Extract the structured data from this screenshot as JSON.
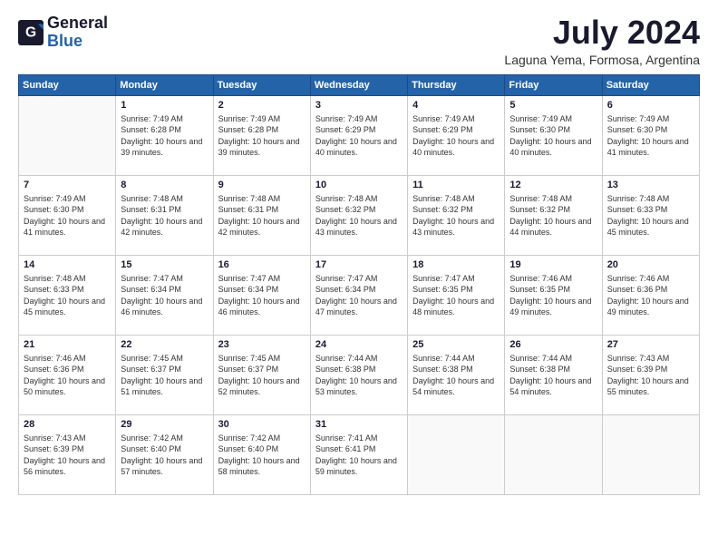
{
  "logo": {
    "text_general": "General",
    "text_blue": "Blue"
  },
  "header": {
    "month_year": "July 2024",
    "location": "Laguna Yema, Formosa, Argentina"
  },
  "weekdays": [
    "Sunday",
    "Monday",
    "Tuesday",
    "Wednesday",
    "Thursday",
    "Friday",
    "Saturday"
  ],
  "weeks": [
    [
      {
        "day": "",
        "sunrise": "",
        "sunset": "",
        "daylight": ""
      },
      {
        "day": "1",
        "sunrise": "Sunrise: 7:49 AM",
        "sunset": "Sunset: 6:28 PM",
        "daylight": "Daylight: 10 hours and 39 minutes."
      },
      {
        "day": "2",
        "sunrise": "Sunrise: 7:49 AM",
        "sunset": "Sunset: 6:28 PM",
        "daylight": "Daylight: 10 hours and 39 minutes."
      },
      {
        "day": "3",
        "sunrise": "Sunrise: 7:49 AM",
        "sunset": "Sunset: 6:29 PM",
        "daylight": "Daylight: 10 hours and 40 minutes."
      },
      {
        "day": "4",
        "sunrise": "Sunrise: 7:49 AM",
        "sunset": "Sunset: 6:29 PM",
        "daylight": "Daylight: 10 hours and 40 minutes."
      },
      {
        "day": "5",
        "sunrise": "Sunrise: 7:49 AM",
        "sunset": "Sunset: 6:30 PM",
        "daylight": "Daylight: 10 hours and 40 minutes."
      },
      {
        "day": "6",
        "sunrise": "Sunrise: 7:49 AM",
        "sunset": "Sunset: 6:30 PM",
        "daylight": "Daylight: 10 hours and 41 minutes."
      }
    ],
    [
      {
        "day": "7",
        "sunrise": "Sunrise: 7:49 AM",
        "sunset": "Sunset: 6:30 PM",
        "daylight": "Daylight: 10 hours and 41 minutes."
      },
      {
        "day": "8",
        "sunrise": "Sunrise: 7:48 AM",
        "sunset": "Sunset: 6:31 PM",
        "daylight": "Daylight: 10 hours and 42 minutes."
      },
      {
        "day": "9",
        "sunrise": "Sunrise: 7:48 AM",
        "sunset": "Sunset: 6:31 PM",
        "daylight": "Daylight: 10 hours and 42 minutes."
      },
      {
        "day": "10",
        "sunrise": "Sunrise: 7:48 AM",
        "sunset": "Sunset: 6:32 PM",
        "daylight": "Daylight: 10 hours and 43 minutes."
      },
      {
        "day": "11",
        "sunrise": "Sunrise: 7:48 AM",
        "sunset": "Sunset: 6:32 PM",
        "daylight": "Daylight: 10 hours and 43 minutes."
      },
      {
        "day": "12",
        "sunrise": "Sunrise: 7:48 AM",
        "sunset": "Sunset: 6:32 PM",
        "daylight": "Daylight: 10 hours and 44 minutes."
      },
      {
        "day": "13",
        "sunrise": "Sunrise: 7:48 AM",
        "sunset": "Sunset: 6:33 PM",
        "daylight": "Daylight: 10 hours and 45 minutes."
      }
    ],
    [
      {
        "day": "14",
        "sunrise": "Sunrise: 7:48 AM",
        "sunset": "Sunset: 6:33 PM",
        "daylight": "Daylight: 10 hours and 45 minutes."
      },
      {
        "day": "15",
        "sunrise": "Sunrise: 7:47 AM",
        "sunset": "Sunset: 6:34 PM",
        "daylight": "Daylight: 10 hours and 46 minutes."
      },
      {
        "day": "16",
        "sunrise": "Sunrise: 7:47 AM",
        "sunset": "Sunset: 6:34 PM",
        "daylight": "Daylight: 10 hours and 46 minutes."
      },
      {
        "day": "17",
        "sunrise": "Sunrise: 7:47 AM",
        "sunset": "Sunset: 6:34 PM",
        "daylight": "Daylight: 10 hours and 47 minutes."
      },
      {
        "day": "18",
        "sunrise": "Sunrise: 7:47 AM",
        "sunset": "Sunset: 6:35 PM",
        "daylight": "Daylight: 10 hours and 48 minutes."
      },
      {
        "day": "19",
        "sunrise": "Sunrise: 7:46 AM",
        "sunset": "Sunset: 6:35 PM",
        "daylight": "Daylight: 10 hours and 49 minutes."
      },
      {
        "day": "20",
        "sunrise": "Sunrise: 7:46 AM",
        "sunset": "Sunset: 6:36 PM",
        "daylight": "Daylight: 10 hours and 49 minutes."
      }
    ],
    [
      {
        "day": "21",
        "sunrise": "Sunrise: 7:46 AM",
        "sunset": "Sunset: 6:36 PM",
        "daylight": "Daylight: 10 hours and 50 minutes."
      },
      {
        "day": "22",
        "sunrise": "Sunrise: 7:45 AM",
        "sunset": "Sunset: 6:37 PM",
        "daylight": "Daylight: 10 hours and 51 minutes."
      },
      {
        "day": "23",
        "sunrise": "Sunrise: 7:45 AM",
        "sunset": "Sunset: 6:37 PM",
        "daylight": "Daylight: 10 hours and 52 minutes."
      },
      {
        "day": "24",
        "sunrise": "Sunrise: 7:44 AM",
        "sunset": "Sunset: 6:38 PM",
        "daylight": "Daylight: 10 hours and 53 minutes."
      },
      {
        "day": "25",
        "sunrise": "Sunrise: 7:44 AM",
        "sunset": "Sunset: 6:38 PM",
        "daylight": "Daylight: 10 hours and 54 minutes."
      },
      {
        "day": "26",
        "sunrise": "Sunrise: 7:44 AM",
        "sunset": "Sunset: 6:38 PM",
        "daylight": "Daylight: 10 hours and 54 minutes."
      },
      {
        "day": "27",
        "sunrise": "Sunrise: 7:43 AM",
        "sunset": "Sunset: 6:39 PM",
        "daylight": "Daylight: 10 hours and 55 minutes."
      }
    ],
    [
      {
        "day": "28",
        "sunrise": "Sunrise: 7:43 AM",
        "sunset": "Sunset: 6:39 PM",
        "daylight": "Daylight: 10 hours and 56 minutes."
      },
      {
        "day": "29",
        "sunrise": "Sunrise: 7:42 AM",
        "sunset": "Sunset: 6:40 PM",
        "daylight": "Daylight: 10 hours and 57 minutes."
      },
      {
        "day": "30",
        "sunrise": "Sunrise: 7:42 AM",
        "sunset": "Sunset: 6:40 PM",
        "daylight": "Daylight: 10 hours and 58 minutes."
      },
      {
        "day": "31",
        "sunrise": "Sunrise: 7:41 AM",
        "sunset": "Sunset: 6:41 PM",
        "daylight": "Daylight: 10 hours and 59 minutes."
      },
      {
        "day": "",
        "sunrise": "",
        "sunset": "",
        "daylight": ""
      },
      {
        "day": "",
        "sunrise": "",
        "sunset": "",
        "daylight": ""
      },
      {
        "day": "",
        "sunrise": "",
        "sunset": "",
        "daylight": ""
      }
    ]
  ]
}
